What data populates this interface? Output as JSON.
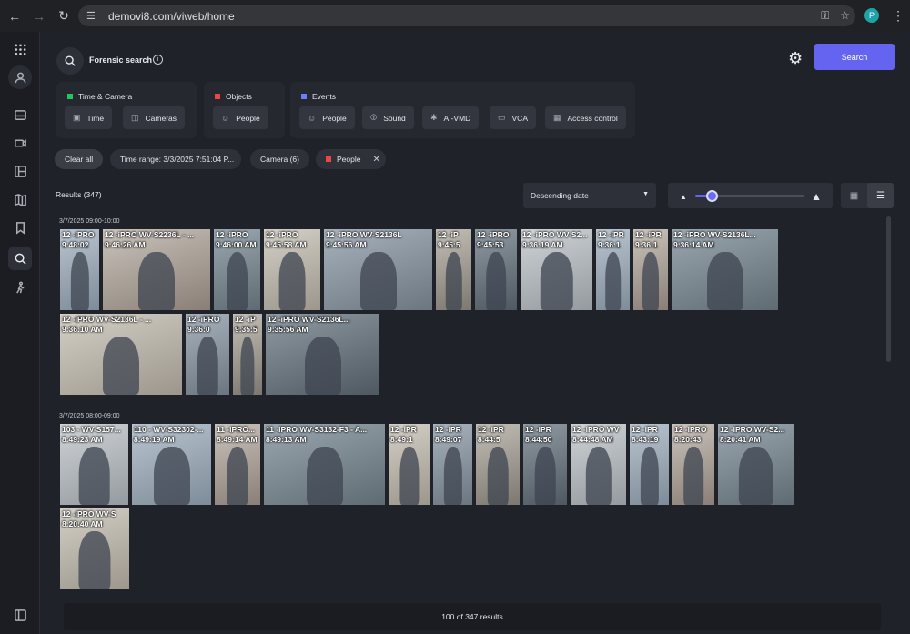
{
  "browser": {
    "url": "demovi8.com/viweb/home",
    "profile_initial": "P"
  },
  "header": {
    "title": "Forensic search",
    "search_label": "Search"
  },
  "groups": [
    {
      "title": "Time & Camera",
      "color": "#22c55e",
      "buttons": [
        "Time",
        "Cameras"
      ]
    },
    {
      "title": "Objects",
      "color": "#ef4444",
      "buttons": [
        "People"
      ]
    },
    {
      "title": "Events",
      "color": "#6b7cff",
      "buttons": [
        "People",
        "Sound",
        "AI-VMD",
        "VCA",
        "Access control"
      ]
    }
  ],
  "filters": {
    "clear_all": "Clear all",
    "time_range": "Time range: 3/3/2025 7:51:04 P...",
    "camera": "Camera (6)",
    "people": "People"
  },
  "results": {
    "title": "Results (347)",
    "sort": "Descending date",
    "zoom_level": 0.15,
    "footer": "100 of 347 results"
  },
  "groups_results": [
    {
      "label": "3/7/2025 09:00-10:00",
      "tiles": [
        {
          "l1": "12 -iPRO",
          "l2": "9:48:02"
        },
        {
          "l1": "12 -iPRO WV-S2236L - ...",
          "l2": "9:46:26 AM"
        },
        {
          "l1": "12 -iPRO",
          "l2": "9:46:00 AM"
        },
        {
          "l1": "12 -iPRO",
          "l2": "9:45:58 AM"
        },
        {
          "l1": "12 -iPRO WV-S2136L",
          "l2": "9:45:56 AM"
        },
        {
          "l1": "12 -iP",
          "l2": "9:45:5"
        },
        {
          "l1": "12 -iPRO",
          "l2": "9:45:53"
        },
        {
          "l1": "12 -iPRO WV-S2...",
          "l2": "9:36:19 AM"
        },
        {
          "l1": "12 -iPR",
          "l2": "9:36:1"
        },
        {
          "l1": "12 -iPR",
          "l2": "9:36:1"
        },
        {
          "l1": "12 -iPRO WV-S2136L...",
          "l2": "9:36:14 AM"
        },
        {
          "l1": "12 -iPRO WV-S2136L - ...",
          "l2": "9:36:10 AM"
        },
        {
          "l1": "12 -iPRO",
          "l2": "9:36:0"
        },
        {
          "l1": "12 -iP",
          "l2": "9:35:5"
        },
        {
          "l1": "12 -iPRO WV-S2136L...",
          "l2": "9:35:56 AM"
        }
      ]
    },
    {
      "label": "3/7/2025 08:00-09:00",
      "tiles": [
        {
          "l1": "103 - WV-S157...",
          "l2": "8:49:23 AM"
        },
        {
          "l1": "110 - WV-S32302-...",
          "l2": "8:49:19 AM"
        },
        {
          "l1": "11 -iPRO...",
          "l2": "8:49:14 AM"
        },
        {
          "l1": "11 -iPRO WV-S3132-F3 - A...",
          "l2": "8:49:13 AM"
        },
        {
          "l1": "12 -iPR",
          "l2": "8:49:1"
        },
        {
          "l1": "12 -iPR",
          "l2": "8:49:07"
        },
        {
          "l1": "12 -iPR",
          "l2": "8:44:5"
        },
        {
          "l1": "12 -iPR",
          "l2": "8:44:50"
        },
        {
          "l1": "12 -iPRO WV",
          "l2": "8:44:48 AM"
        },
        {
          "l1": "12 -iPR",
          "l2": "8:43:19"
        },
        {
          "l1": "12 -iPRO",
          "l2": "8:20:43"
        },
        {
          "l1": "12 -iPRO WV-S2...",
          "l2": "8:20:41 AM"
        },
        {
          "l1": "12 -iPRO WV-S",
          "l2": "8:20:40 AM"
        }
      ]
    }
  ]
}
